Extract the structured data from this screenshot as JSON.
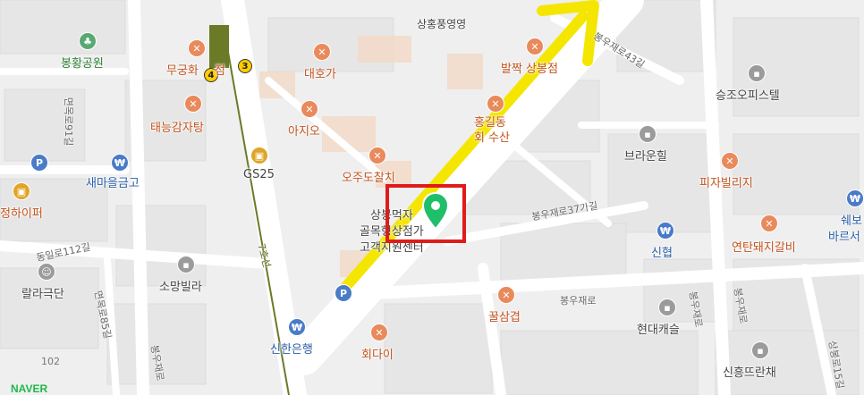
{
  "map": {
    "watermark": "NAVER",
    "scale_number": "102",
    "accent_colors": {
      "arrow": "#f4e600",
      "selection": "#e01b1b",
      "pin": "#1fbf6a"
    },
    "subway": {
      "line_label": "7호선",
      "badge_4": "4",
      "badge_3": "3"
    },
    "pois": {
      "park": "봉황공원",
      "mugung": "무궁화",
      "mugung_suffix": "점",
      "taeneung": "태능감자탕",
      "gs25": "GS25",
      "saemaeul": "새마을금고",
      "jeonghaipeo": "정하이퍼",
      "rallagukdan": "랄라극단",
      "somang": "소망빌라",
      "shinhan": "신한은행",
      "daehoga": "대호가",
      "ajio": "아지오",
      "ojudo": "오주도찰치",
      "balljjak": "발짝 상봉점",
      "honggildong_1": "홍길동",
      "honggildong_2": "회 수산",
      "sangbong_1": "상봉먹자",
      "sangbong_2": "골목형상점가",
      "sangbong_3": "고객지원센터",
      "kkulsamgyeop": "꿀삼겹",
      "hoedai": "회다이",
      "seungjo": "승조오피스텔",
      "brownhill": "브라운힐",
      "pizzavillage": "피자빌리지",
      "shinhyeop": "신협",
      "yeontan": "연탄돼지갈비",
      "swebo_1": "쉐보",
      "swebo_2": "바르서",
      "hyundai": "현대캐슬",
      "sinheung": "신흥뜨란채",
      "sanghong_top": "상홍풍영영"
    },
    "streets": {
      "bongu43": "봉우재로43길",
      "bongu37": "봉우재로37가길",
      "bongu": "봉우재로",
      "myeonmok91": "면목로91길",
      "dongil112": "동일로112길",
      "myeonmok85": "면목로85길",
      "bongujae_v1": "봉우재로",
      "bongujae_v2": "봉우재로",
      "bongujae_v3": "봉우재로",
      "sangbong15": "상봉로15길"
    }
  }
}
